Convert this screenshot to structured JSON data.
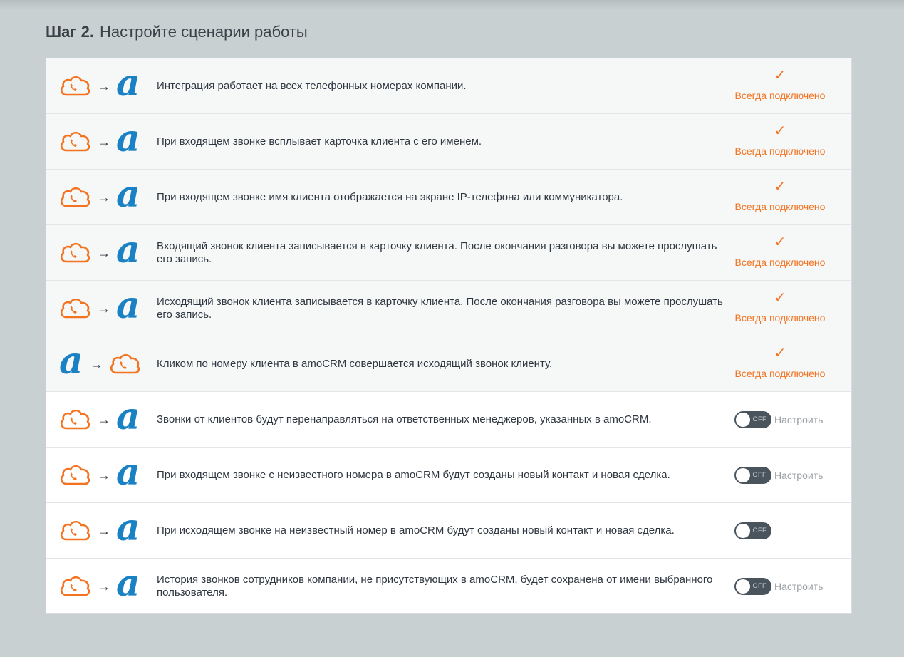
{
  "heading": {
    "step": "Шаг  2.",
    "title": "Настройте сценарии работы"
  },
  "colors": {
    "accent": "#f37321",
    "amo_blue": "#1a82c4",
    "toggle_off": "#4a545d"
  },
  "rows": [
    {
      "text": "Интеграция работает на всех телефонных номерах компании.",
      "status": "Всегда подключено"
    },
    {
      "text": "При входящем звонке всплывает карточка клиента с его именем.",
      "status": "Всегда подключено"
    },
    {
      "text": "При входящем звонке имя клиента отображается на экране IP-телефона или коммуникатора.",
      "status": "Всегда подключено"
    },
    {
      "text": "Входящий звонок клиента записывается в карточку клиента. После окончания разговора вы можете прослушать его запись.",
      "status": "Всегда подключено"
    },
    {
      "text": "Исходящий звонок клиента записывается в карточку клиента. После окончания разговора вы можете прослушать его запись.",
      "status": "Всегда подключено"
    },
    {
      "text": "Кликом по номеру клиента в amoCRM совершается исходящий звонок клиенту.",
      "status": "Всегда подключено"
    },
    {
      "text": "Звонки от клиентов будут перенаправляться на ответственных менеджеров, указанных в amoCRM.",
      "toggle": "OFF",
      "configure": "Настроить"
    },
    {
      "text": "При входящем звонке с неизвестного номера в amoCRM будут созданы новый контакт и новая сделка.",
      "toggle": "OFF",
      "configure": "Настроить"
    },
    {
      "text": "При исходящем звонке на неизвестный номер в amoCRM будут созданы новый контакт и новая сделка.",
      "toggle": "OFF"
    },
    {
      "text": "История звонков сотрудников компании, не присутствующих в amoCRM, будет сохранена от имени выбранного пользователя.",
      "toggle": "OFF",
      "configure": "Настроить"
    }
  ],
  "icons": {
    "arrow": "→",
    "amo_letter": "a",
    "check": "✓"
  }
}
